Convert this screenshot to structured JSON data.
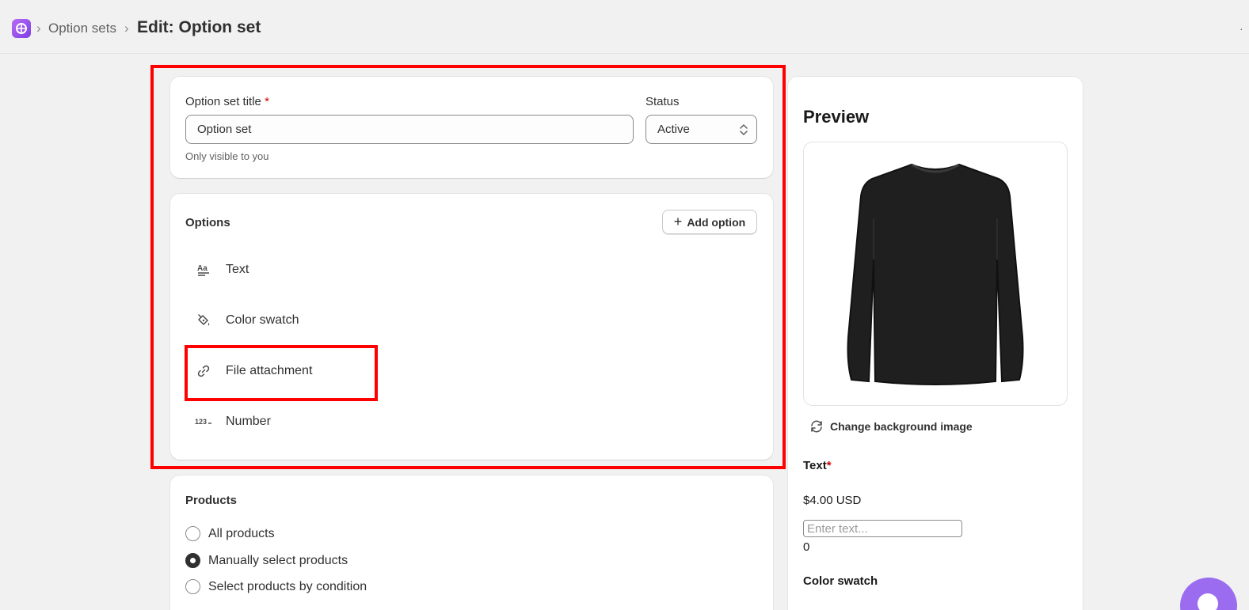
{
  "breadcrumb": {
    "parent": "Option sets",
    "separator": "›",
    "title": "Edit: Option set"
  },
  "details": {
    "title_label": "Option set title",
    "required_mark": "*",
    "title_value": "Option set",
    "title_help": "Only visible to you",
    "status_label": "Status",
    "status_value": "Active"
  },
  "options": {
    "heading": "Options",
    "add_button_label": "Add option",
    "items": [
      {
        "label": "Text",
        "icon": "text-format-icon"
      },
      {
        "label": "Color swatch",
        "icon": "paint-bucket-icon"
      },
      {
        "label": "File attachment",
        "icon": "link-icon"
      },
      {
        "label": "Number",
        "icon": "number-icon"
      }
    ]
  },
  "products": {
    "heading": "Products",
    "choices": [
      {
        "label": "All products",
        "selected": false
      },
      {
        "label": "Manually select products",
        "selected": true
      },
      {
        "label": "Select products by condition",
        "selected": false
      }
    ]
  },
  "preview": {
    "heading": "Preview",
    "change_bg_label": "Change background image",
    "text_option_label": "Text",
    "required_mark": "*",
    "price": "$4.00 USD",
    "input_placeholder": "Enter text...",
    "char_count": "0",
    "color_swatch_label": "Color swatch"
  },
  "colors": {
    "highlight": "#ff0000",
    "brand_purple": "#9b6cf0"
  }
}
